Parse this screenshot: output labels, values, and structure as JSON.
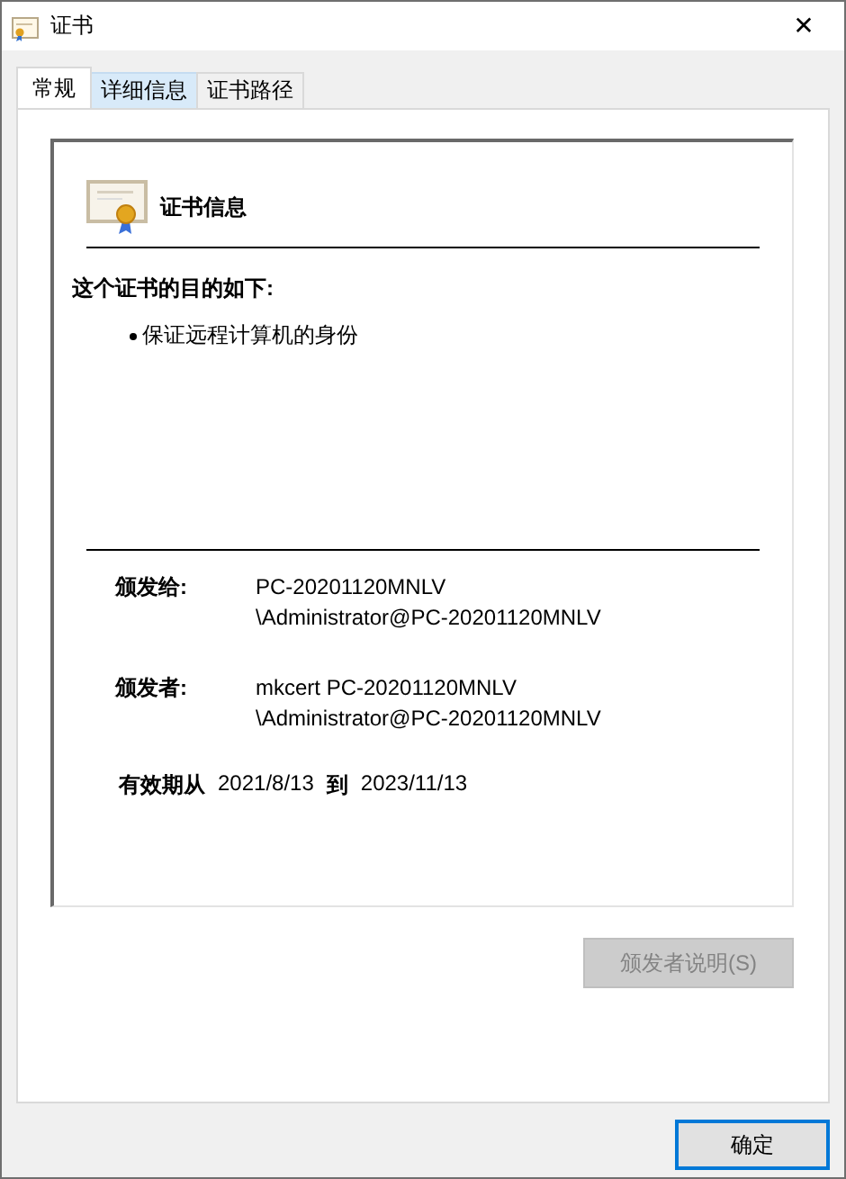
{
  "window": {
    "title": "证书",
    "close": "✕"
  },
  "tabs": [
    {
      "label": "常规",
      "selected": true,
      "hovered": false
    },
    {
      "label": "详细信息",
      "selected": false,
      "hovered": true
    },
    {
      "label": "证书路径",
      "selected": false,
      "hovered": false
    }
  ],
  "info": {
    "heading": "证书信息",
    "purpose_title": "这个证书的目的如下:",
    "purposes": [
      "保证远程计算机的身份"
    ],
    "fields": [
      {
        "label": "颁发给:",
        "lines": [
          "PC-20201120MNLV",
          "\\Administrator@PC-20201120MNLV"
        ]
      },
      {
        "label": "颁发者:",
        "lines": [
          "mkcert PC-20201120MNLV",
          "\\Administrator@PC-20201120MNLV"
        ]
      }
    ],
    "validity": {
      "from_label": "有效期从",
      "from": "2021/8/13",
      "to_label": "到",
      "to": "2023/11/13"
    }
  },
  "issuer_button": {
    "label": "颁发者说明(S)",
    "disabled": true
  },
  "ok_button": {
    "label": "确定",
    "focused": true
  }
}
